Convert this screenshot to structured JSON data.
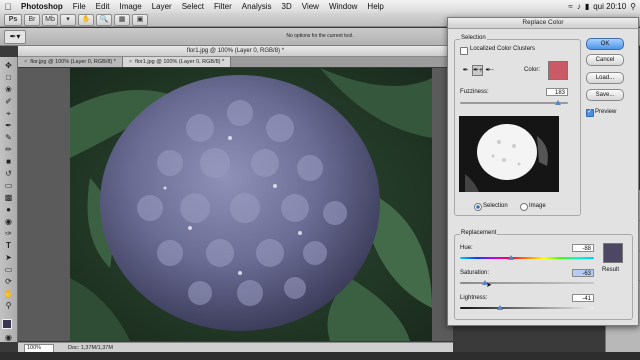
{
  "menubar": {
    "app_name": "Photoshop",
    "items": [
      "File",
      "Edit",
      "Image",
      "Layer",
      "Select",
      "Filter",
      "Analysis",
      "3D",
      "View",
      "Window",
      "Help"
    ],
    "clock": "qui 20:10"
  },
  "optionsbar": {
    "message": "No options for the current tool."
  },
  "window": {
    "title": "flor1.jpg @ 100% (Layer 0, RGB/8) *"
  },
  "tabs": [
    {
      "label": "flor.jpg @ 100% (Layer 0, RGB/8) *"
    },
    {
      "label": "flor1.jpg @ 100% (Layer 0, RGB/8) *"
    }
  ],
  "status": {
    "zoom": "100%",
    "doc": "Doc: 1,37M/1,37M"
  },
  "dialog": {
    "title": "Replace Color",
    "selection_group": "Selection",
    "localized_label": "Localized Color Clusters",
    "localized_checked": false,
    "color_label": "Color:",
    "selected_color": "#c95a66",
    "fuzziness_label": "Fuzziness:",
    "fuzziness_value": "183",
    "fuzziness_fraction": 0.91,
    "radio_selection": "Selection",
    "radio_image": "Image",
    "replacement_group": "Replacement",
    "hue_label": "Hue:",
    "hue_value": "-88",
    "hue_fraction": 0.38,
    "saturation_label": "Saturation:",
    "saturation_value": "-63",
    "saturation_fraction": 0.19,
    "lightness_label": "Lightness:",
    "lightness_value": "-41",
    "lightness_fraction": 0.3,
    "result_label": "Result",
    "result_color": "#4d4764",
    "buttons": {
      "ok": "OK",
      "cancel": "Cancel",
      "load": "Load...",
      "save": "Save..."
    },
    "preview_label": "Preview",
    "preview_checked": true
  }
}
